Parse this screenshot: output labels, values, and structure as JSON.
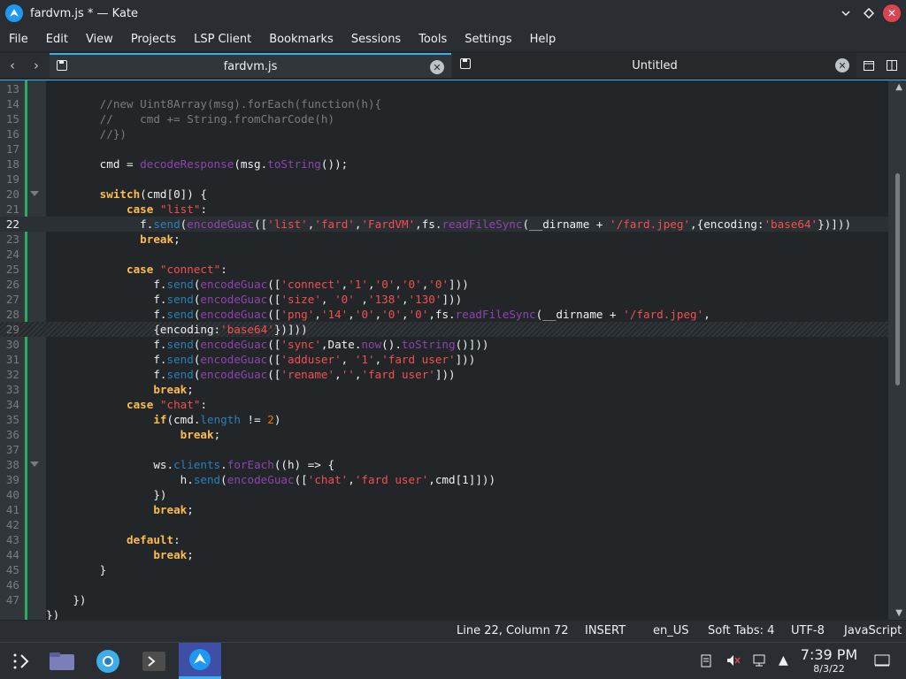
{
  "window": {
    "title": "fardvm.js * — Kate"
  },
  "menu": [
    "File",
    "Edit",
    "View",
    "Projects",
    "LSP Client",
    "Bookmarks",
    "Sessions",
    "Tools",
    "Settings",
    "Help"
  ],
  "tabs": [
    {
      "label": "fardvm.js",
      "active": true
    },
    {
      "label": "Untitled",
      "active": false
    }
  ],
  "editor": {
    "line_numbers": [
      "13",
      "14",
      "15",
      "16",
      "17",
      "18",
      "19",
      "20",
      "21",
      "22",
      "23",
      "24",
      "25",
      "26",
      "27",
      "28",
      "29",
      "30",
      "31",
      "32",
      "33",
      "34",
      "35",
      "36",
      "37",
      "38",
      "39",
      "40",
      "41",
      "42",
      "43",
      "44",
      "45",
      "46",
      "47"
    ],
    "lines": [
      "",
      "        //new Uint8Array(msg).forEach(function(h){",
      "        //    cmd += String.fromCharCode(h)",
      "        //})",
      "",
      "        cmd = decodeResponse(msg.toString());",
      "",
      "        switch(cmd[0]) {",
      "            case \"list\":",
      "              f.send(encodeGuac(['list','fard','FardVM',fs.readFileSync(__dirname + '/fard.jpeg',{encoding:'base64'})]))",
      "              break;",
      "",
      "            case \"connect\":",
      "                f.send(encodeGuac(['connect','1','0','0','0']))",
      "                f.send(encodeGuac(['size', '0' ,'138','130']))",
      "                f.send(encodeGuac(['png','14','0','0','0',fs.readFileSync(__dirname + '/fard.jpeg',",
      "                {encoding:'base64'})]))",
      "                f.send(encodeGuac(['sync',Date.now().toString()]))",
      "                f.send(encodeGuac(['adduser', '1','fard user']))",
      "                f.send(encodeGuac(['rename','','fard user']))",
      "                break;",
      "            case \"chat\":",
      "                if(cmd.length != 2)",
      "                    break;",
      "",
      "                ws.clients.forEach((h) => {",
      "                    h.send(encodeGuac(['chat','fard user',cmd[1]]))",
      "                })",
      "                break;",
      "",
      "            default:",
      "                break;",
      "        }",
      "",
      "    })",
      "})"
    ]
  },
  "status": {
    "position": "Line 22, Column 72",
    "mode": "INSERT",
    "dictionary": "en_US",
    "indent": "Soft Tabs: 4",
    "encoding": "UTF-8",
    "language": "JavaScript"
  },
  "clock": {
    "time": "7:39 PM",
    "date": "8/3/22"
  }
}
